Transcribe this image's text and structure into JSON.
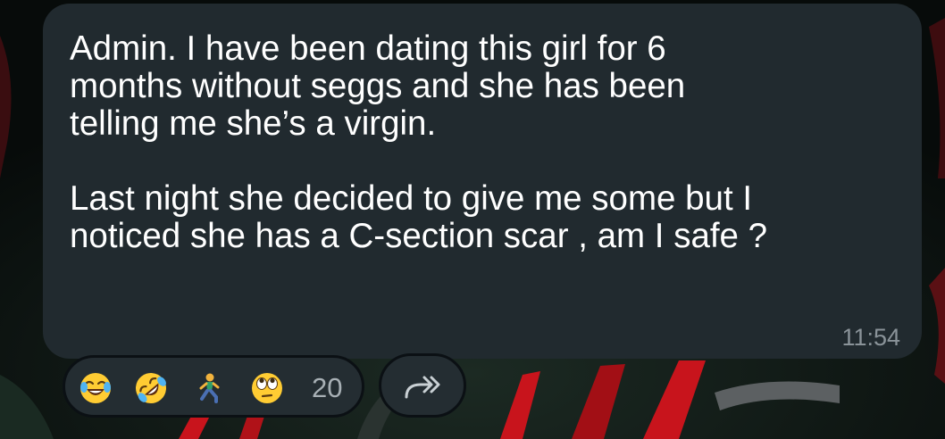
{
  "message": {
    "text": "Admin. I have been dating this girl for 6\nmonths without seggs and she has been\ntelling me she’s a virgin.\n\nLast night she decided to give me some but I\nnoticed she has a C-section scar , am I safe ?",
    "time": "11:54"
  },
  "reactions": {
    "items": [
      {
        "icon": "face-with-tears-of-joy-icon"
      },
      {
        "icon": "rolling-on-floor-laughing-icon"
      },
      {
        "icon": "person-running-icon"
      },
      {
        "icon": "face-with-rolling-eyes-icon"
      }
    ],
    "count": "20"
  },
  "forward": {
    "icon": "forward-arrow-icon"
  },
  "colors": {
    "bubble": "#212a2f",
    "message_text": "#ffffff",
    "timestamp": "#8a9399",
    "pill_background": "#242d32",
    "wallpaper_accent": "#c8141c"
  }
}
